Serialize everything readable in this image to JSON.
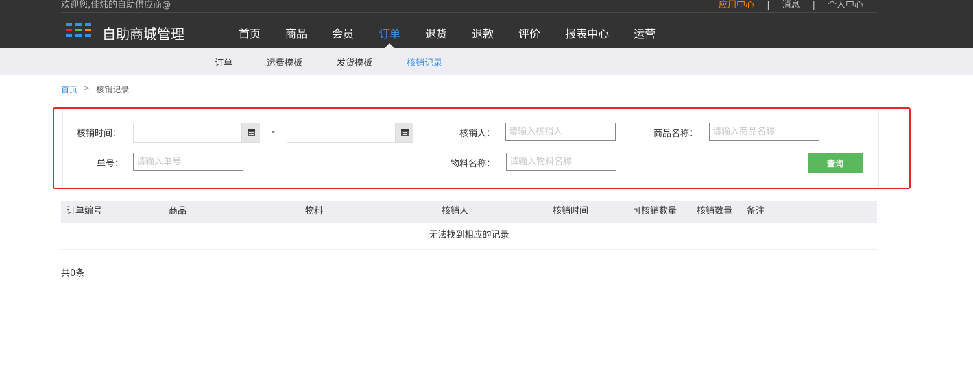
{
  "header": {
    "welcome": "欢迎您,佳炜的自助供应商@",
    "app_center": "应用中心",
    "messages": "消息",
    "personal_center": "个人中心",
    "separator": "|",
    "brand": "自助商城管理",
    "accent_color": "#3a8fe6",
    "highlight_color": "#ff8a00",
    "logo_colors": [
      "#3a8fe6",
      "#e8242b",
      "#5cb85c",
      "#ff8a00"
    ]
  },
  "nav": {
    "items": [
      {
        "label": "首页"
      },
      {
        "label": "商品"
      },
      {
        "label": "会员"
      },
      {
        "label": "订单",
        "active": true
      },
      {
        "label": "退货"
      },
      {
        "label": "退款"
      },
      {
        "label": "评价"
      },
      {
        "label": "报表中心"
      },
      {
        "label": "运营"
      }
    ]
  },
  "subnav": {
    "items": [
      {
        "label": "订单"
      },
      {
        "label": "运费模板"
      },
      {
        "label": "发货模板"
      },
      {
        "label": "核销记录",
        "active": true
      }
    ]
  },
  "breadcrumb": {
    "home": "首页",
    "arrow": ">",
    "current": "核销记录"
  },
  "filter": {
    "time_label": "核销时间：",
    "date_sep": "-",
    "date_start_value": "",
    "date_end_value": "",
    "verifier_label": "核销人：",
    "verifier_placeholder": "请输入核销人",
    "product_label": "商品名称：",
    "product_placeholder": "请输入商品名称",
    "order_label": "单号：",
    "order_placeholder": "请输入单号",
    "material_label": "物料名称：",
    "material_placeholder": "请输入物料名称",
    "query_label": "查询"
  },
  "table": {
    "columns": [
      "订单编号",
      "商品",
      "物料",
      "核销人",
      "核销时间",
      "可核销数量",
      "核销数量",
      "备注"
    ],
    "empty_text": "无法找到相应的记录"
  },
  "footer": {
    "total": "共0条"
  }
}
